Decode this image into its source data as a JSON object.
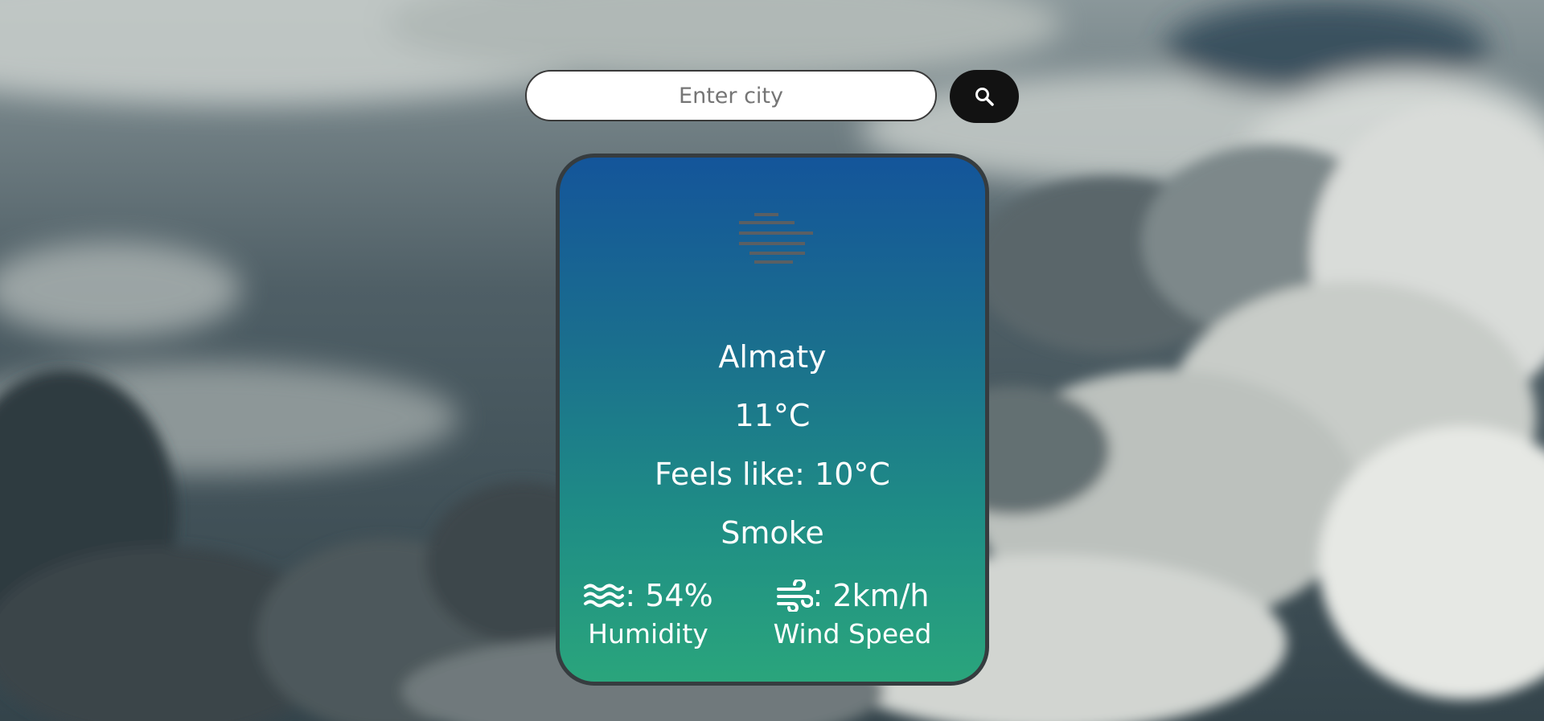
{
  "search": {
    "placeholder": "Enter city",
    "value": "",
    "button_icon": "search-icon"
  },
  "weather": {
    "icon": "mist-icon",
    "city": "Almaty",
    "temperature": "11°C",
    "feels_like": "Feels like: 10°C",
    "condition": "Smoke",
    "humidity": {
      "icon": "humidity-waves-icon",
      "value": ": 54%",
      "label": "Humidity"
    },
    "wind": {
      "icon": "wind-icon",
      "value": ": 2km/h",
      "label": "Wind Speed"
    }
  },
  "colors": {
    "card_gradient_top": "#14559a",
    "card_gradient_bottom": "#2aa57c",
    "card_border": "#363c3f",
    "search_button": "#121212",
    "text": "#ffffff"
  }
}
